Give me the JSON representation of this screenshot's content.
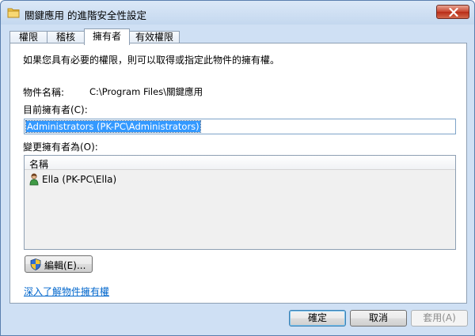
{
  "window": {
    "title": "關鍵應用 的進階安全性設定",
    "close_icon": "close-icon"
  },
  "tabs": [
    {
      "label": "權限",
      "active": false
    },
    {
      "label": "稽核",
      "active": false
    },
    {
      "label": "擁有者",
      "active": true
    },
    {
      "label": "有效權限",
      "active": false
    }
  ],
  "owner_panel": {
    "intro": "如果您具有必要的權限，則可以取得或指定此物件的擁有權。",
    "object_name_label": "物件名稱:",
    "object_name_value": "C:\\Program Files\\關鍵應用",
    "current_owner_label": "目前擁有者(C):",
    "current_owner_value": "Administrators (PK-PC\\Administrators)",
    "change_owner_label": "變更擁有者為(O):",
    "list": {
      "column_header": "名稱",
      "items": [
        {
          "label": "Ella (PK-PC\\Ella)",
          "icon": "user-icon"
        }
      ]
    },
    "edit_button": "編輯(E)...",
    "learn_more_link": "深入了解物件擁有權"
  },
  "footer": {
    "ok_label": "確定",
    "cancel_label": "取消",
    "apply_label": "套用(A)"
  },
  "colors": {
    "selection": "#3399ff",
    "link": "#0066cc",
    "close_red": "#c8452f",
    "frame": "#cfe0f4"
  }
}
